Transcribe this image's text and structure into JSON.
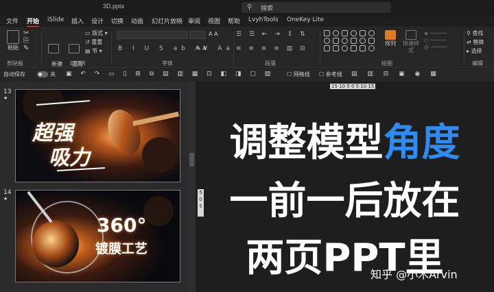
{
  "window": {
    "filename": "3D.pptx",
    "search_placeholder": "搜索"
  },
  "menu": {
    "tabs": [
      "文件",
      "开始",
      "iSlide",
      "插入",
      "设计",
      "切换",
      "动画",
      "幻灯片放映",
      "审阅",
      "视图",
      "帮助",
      "LvyhTools",
      "OneKey Lite"
    ],
    "active": "开始"
  },
  "ribbon": {
    "groups": {
      "clipboard": "剪贴板",
      "slides": "幻灯片",
      "font": "字体",
      "paragraph": "段落",
      "drawing": "绘图",
      "editing": "编辑"
    },
    "paste": "粘贴",
    "new_slide": "新建\n幻灯片",
    "reuse_slide": "重用\n幻灯片",
    "layout": "版式",
    "reset": "重置",
    "section": "节",
    "arrange": "排列",
    "quick_styles": "快速样式",
    "find": "查找",
    "replace": "替换",
    "select": "选择"
  },
  "qat": {
    "autosave": "自动保存",
    "autosave_state": "关",
    "gridlines": "网格线",
    "guides": "参考线"
  },
  "thumbnails": [
    {
      "number": "13",
      "marker": "★",
      "title_line1": "超强",
      "title_line2": "吸力"
    },
    {
      "number": "14",
      "marker": "★",
      "title_line1": "360°",
      "title_line2": "镀膜工艺"
    }
  ],
  "ruler": {
    "horizontal": "15 10 5 0 5 10 15",
    "vertical": "5 0 5"
  },
  "overlay": {
    "line1_a": "调整模型",
    "line1_b": "角度",
    "line2": "一前一后放在",
    "line3": "两页PPT里",
    "credit": "知乎 @小木Arvin",
    "highlight_color": "#2d8cf0"
  }
}
